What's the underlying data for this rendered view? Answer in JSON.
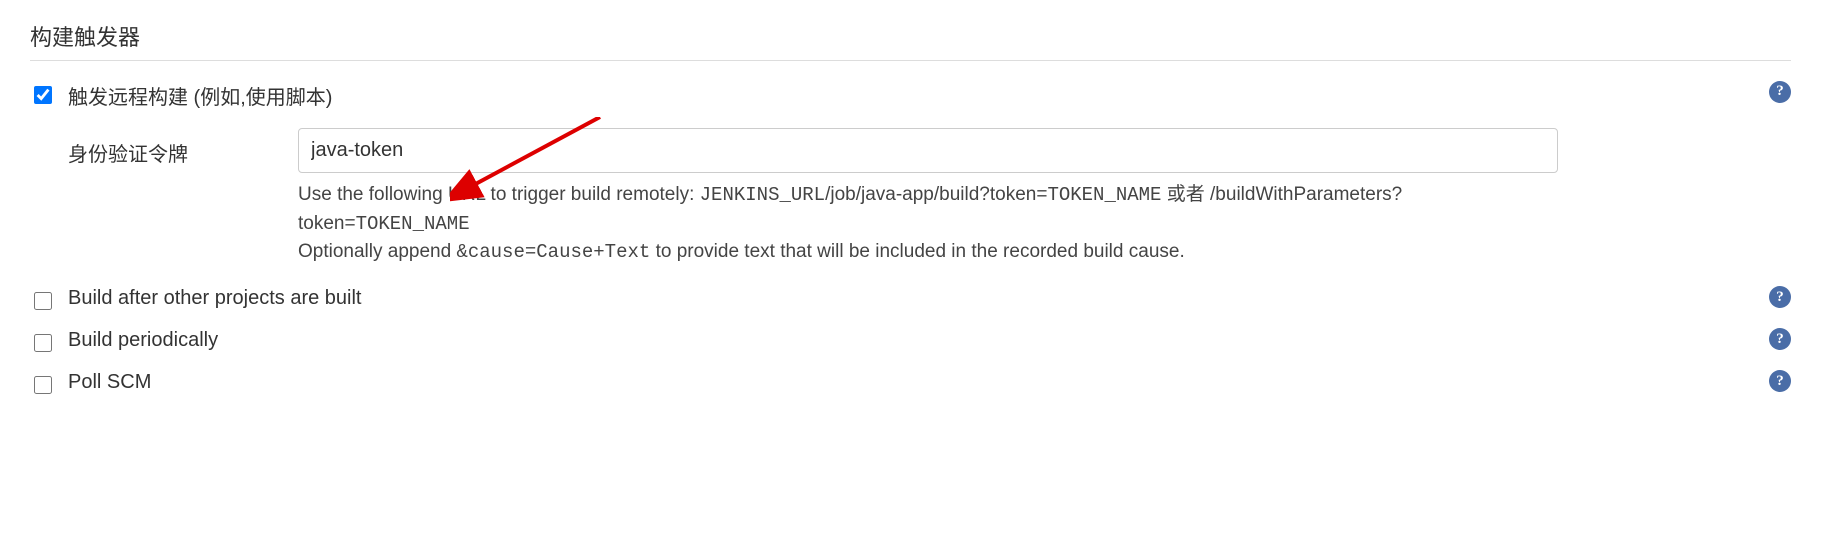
{
  "section": {
    "title": "构建触发器"
  },
  "triggers": {
    "remote": {
      "label": "触发远程构建 (例如,使用脚本)",
      "checked": true,
      "token_label": "身份验证令牌",
      "token_value": "java-token",
      "help": {
        "line1_prefix": "Use the following URL to trigger build remotely: ",
        "line1_code1": "JENKINS_URL",
        "line1_mid": "/job/java-app/build?token=",
        "line1_code2": "TOKEN_NAME",
        "line1_or": " 或者 /buildWithParameters?token=",
        "line1_code3": "TOKEN_NAME",
        "line2_prefix": "Optionally append ",
        "line2_code": "&cause=Cause+Text",
        "line2_suffix": " to provide text that will be included in the recorded build cause."
      }
    },
    "build_after": {
      "label": "Build after other projects are built",
      "checked": false
    },
    "periodic": {
      "label": "Build periodically",
      "checked": false
    },
    "poll_scm": {
      "label": "Poll SCM",
      "checked": false
    }
  }
}
